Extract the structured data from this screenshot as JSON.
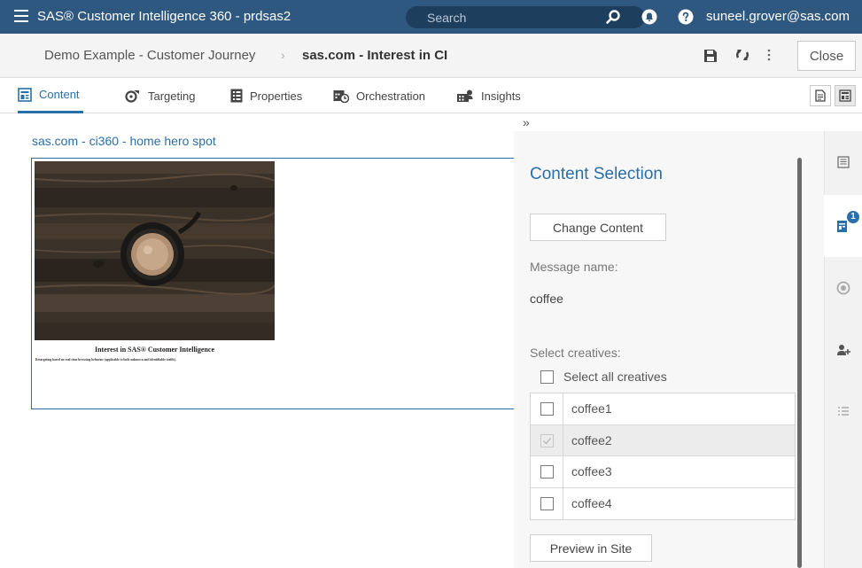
{
  "topbar": {
    "app_title": "SAS® Customer Intelligence 360 - prdsas2",
    "search_placeholder": "Search",
    "user": "suneel.grover@sas.com",
    "color": "#2f5880"
  },
  "breadcrumb": {
    "parent": "Demo Example - Customer Journey",
    "separator": "›",
    "current": "sas.com - Interest in CI"
  },
  "toolbar": {
    "close_label": "Close"
  },
  "tabs": [
    {
      "label": "Content",
      "icon": "content-icon",
      "active": true
    },
    {
      "label": "Targeting",
      "icon": "targeting-icon",
      "active": false
    },
    {
      "label": "Properties",
      "icon": "properties-icon",
      "active": false
    },
    {
      "label": "Orchestration",
      "icon": "orchestration-icon",
      "active": false
    },
    {
      "label": "Insights",
      "icon": "insights-icon",
      "active": false
    }
  ],
  "main": {
    "content_title": "sas.com - ci360 - home hero spot",
    "preview": {
      "image": "coffee-cup-on-wood-image",
      "heading": "Interest in SAS® Customer Intelligence",
      "subtext": "Retargeting based on real-time browsing behavior (applicable to both unknown and identifiable traffic)."
    }
  },
  "panel": {
    "collapse": "»",
    "title": "Content Selection",
    "change_content_label": "Change Content",
    "message_name_label": "Message name:",
    "message_name_value": "coffee",
    "select_creatives_label": "Select creatives:",
    "select_all_label": "Select all creatives",
    "creatives": [
      {
        "name": "coffee1",
        "checked": false
      },
      {
        "name": "coffee2",
        "checked": true
      },
      {
        "name": "coffee3",
        "checked": false
      },
      {
        "name": "coffee4",
        "checked": false
      }
    ],
    "preview_label": "Preview in Site"
  },
  "rail": {
    "badge_count": "1",
    "items": [
      "details-icon",
      "content-selection-icon",
      "audience-icon",
      "add-user-icon",
      "list-icon"
    ]
  },
  "colors": {
    "accent": "#2a6fa8",
    "topbar": "#2f5880"
  }
}
